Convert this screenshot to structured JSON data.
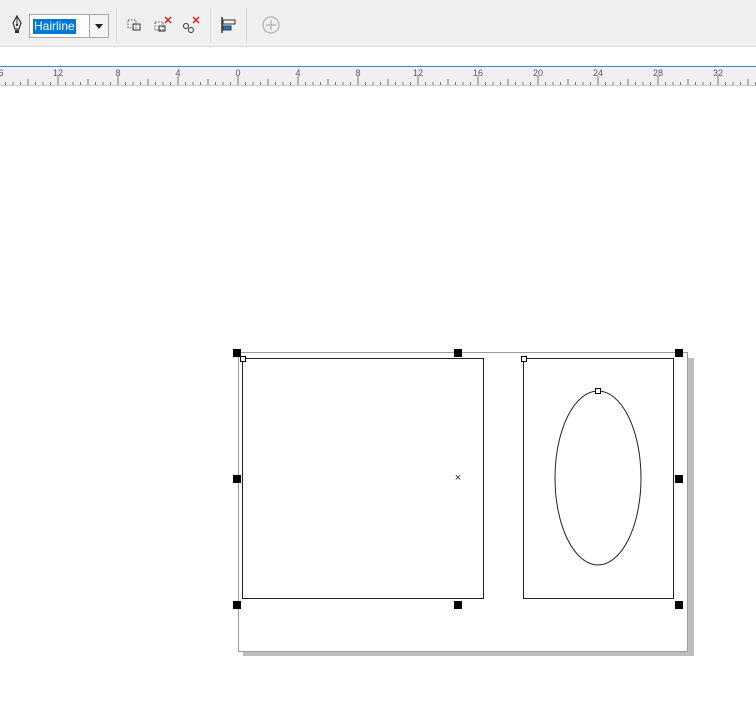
{
  "toolbar": {
    "outline_width": "Hairline",
    "icons": [
      "pen-tool-icon",
      "combine-icon",
      "break-apart-icon",
      "break-curve-icon",
      "align-icon",
      "add-icon"
    ]
  },
  "ruler": {
    "labels": [
      "6",
      "12",
      "8",
      "4",
      "0",
      "4",
      "8",
      "12",
      "16",
      "20",
      "24",
      "28",
      "32"
    ]
  },
  "canvas": {
    "center_mark": "×",
    "colors": {
      "accent": "#0078d7",
      "ruler_top_border": "#3c8ad6",
      "shadow": "#bdbdbd"
    }
  }
}
